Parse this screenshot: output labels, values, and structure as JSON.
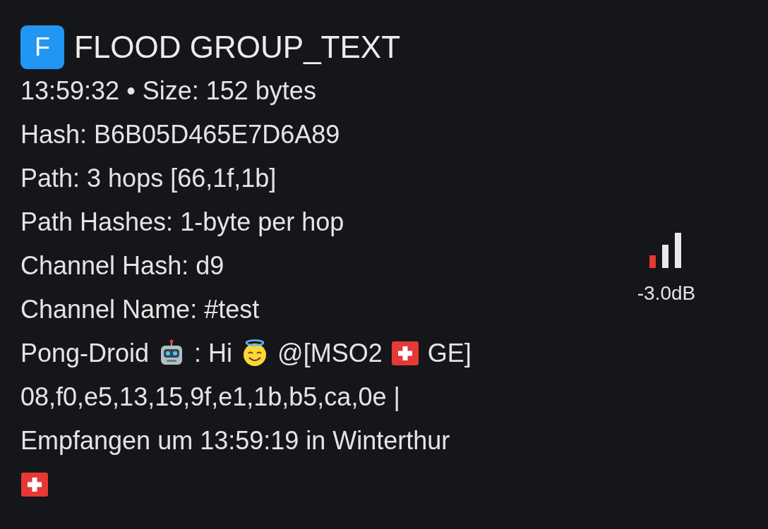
{
  "header": {
    "badge": "F",
    "title": "FLOOD GROUP_TEXT"
  },
  "lines": [
    {
      "segments": [
        {
          "kind": "text",
          "text": "13:59:32 • Size: 152 bytes"
        }
      ]
    },
    {
      "segments": [
        {
          "kind": "text",
          "text": "Hash: B6B05D465E7D6A89"
        }
      ]
    },
    {
      "segments": [
        {
          "kind": "text",
          "text": "Path: 3 hops [66,1f,1b]"
        }
      ]
    },
    {
      "segments": [
        {
          "kind": "text",
          "text": "Path Hashes: 1-byte per hop"
        }
      ]
    },
    {
      "segments": [
        {
          "kind": "text",
          "text": "Channel Hash: d9"
        }
      ]
    },
    {
      "segments": [
        {
          "kind": "text",
          "text": "Channel Name: #test"
        }
      ]
    },
    {
      "segments": [
        {
          "kind": "text",
          "text": "Pong-Droid"
        },
        {
          "kind": "robot"
        },
        {
          "kind": "text",
          "text": ": Hi"
        },
        {
          "kind": "angel"
        },
        {
          "kind": "text",
          "text": "@[MSO2"
        },
        {
          "kind": "flag"
        },
        {
          "kind": "text",
          "text": "GE]"
        }
      ]
    },
    {
      "segments": [
        {
          "kind": "text",
          "text": "08,f0,e5,13,15,9f,e1,1b,b5,ca,0e |"
        }
      ]
    },
    {
      "segments": [
        {
          "kind": "text",
          "text": "Empfangen um 13:59:19 in Winterthur"
        }
      ]
    },
    {
      "segments": [
        {
          "kind": "flag"
        }
      ]
    }
  ],
  "signal": {
    "reading": "-3.0dB"
  }
}
